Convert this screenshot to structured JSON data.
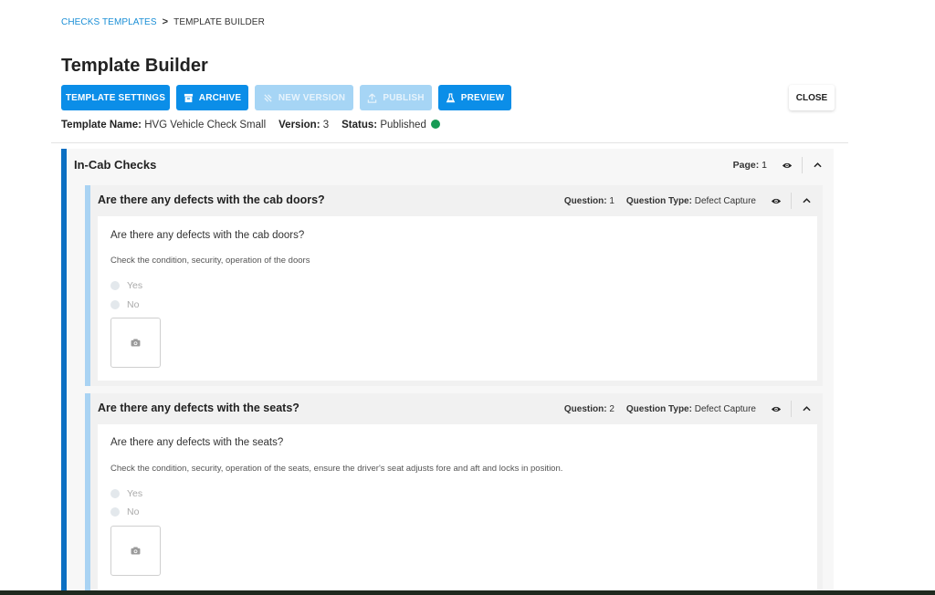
{
  "breadcrumb": {
    "parent": "CHECKS TEMPLATES",
    "separator": ">",
    "current": "TEMPLATE BUILDER"
  },
  "page_title": "Template Builder",
  "toolbar": {
    "template_settings": "TEMPLATE SETTINGS",
    "archive": "ARCHIVE",
    "new_version": "NEW VERSION",
    "publish": "PUBLISH",
    "preview": "PREVIEW",
    "close": "CLOSE"
  },
  "meta": {
    "name_label": "Template Name:",
    "name_value": "HVG Vehicle Check Small",
    "version_label": "Version:",
    "version_value": "3",
    "status_label": "Status:",
    "status_value": "Published",
    "status_color": "#179b55"
  },
  "section": {
    "title": "In-Cab Checks",
    "page_label": "Page:",
    "page_value": "1"
  },
  "questions": [
    {
      "header": "Are there any defects with the cab doors?",
      "question_label": "Question:",
      "question_number": "1",
      "type_label": "Question Type:",
      "type_value": "Defect Capture",
      "text": "Are there any defects with the cab doors?",
      "hint": "Check the condition, security, operation of the doors",
      "options": [
        "Yes",
        "No"
      ]
    },
    {
      "header": "Are there any defects with the seats?",
      "question_label": "Question:",
      "question_number": "2",
      "type_label": "Question Type:",
      "type_value": "Defect Capture",
      "text": "Are there any defects with the seats?",
      "hint": "Check the condition, security, operation of the seats, ensure the driver's seat adjusts fore and aft and locks in position.",
      "options": [
        "Yes",
        "No"
      ]
    }
  ],
  "colors": {
    "primary": "#0b8ee8",
    "primary_disabled": "#a6d5f5",
    "page_accent": "#0b6fc2",
    "question_accent": "#a9d3f3",
    "link": "#1b8fd6"
  },
  "icons": {
    "archive": "archive-box-icon",
    "new_version": "new-version-icon",
    "publish": "upload-icon",
    "preview": "flask-icon",
    "visibility": "eye-icon",
    "collapse": "chevron-up-icon",
    "photo": "camera-icon"
  }
}
